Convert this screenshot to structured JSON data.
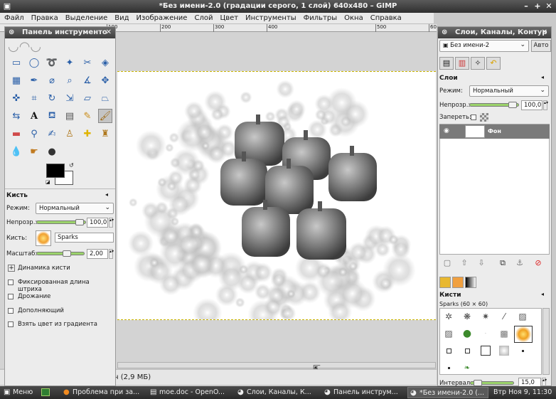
{
  "window": {
    "title": "*Без имени-2.0 (градации серого, 1 слой) 640x480 – GIMP"
  },
  "menubar": [
    "Файл",
    "Правка",
    "Выделение",
    "Вид",
    "Изображение",
    "Слой",
    "Цвет",
    "Инструменты",
    "Фильтры",
    "Окна",
    "Справка"
  ],
  "ruler": {
    "ticks": [
      "100",
      "200",
      "300",
      "400",
      "500",
      "60"
    ]
  },
  "status": {
    "text": "н (2,9 МБ)"
  },
  "toolbox": {
    "title": "Панель инструменто",
    "section": "Кисть",
    "mode_label": "Режим:",
    "mode_value": "Нормальный",
    "opacity_label": "Непрозр.:",
    "opacity_value": "100,0",
    "opacity_fraction": 1.0,
    "brush_label": "Кисть:",
    "brush_value": "Sparks",
    "scale_label": "Масштаб:",
    "scale_value": "2,00",
    "dynamics": "Динамика кисти",
    "options": [
      "Фиксированная длина штриха",
      "Дрожание",
      "Дополняющий",
      "Взять цвет из градиента"
    ]
  },
  "layers": {
    "title": "Слои, Каналы, Контур",
    "image_select": "Без имени-2",
    "auto_button": "Авто",
    "section": "Слои",
    "mode_label": "Режим:",
    "mode_value": "Нормальный",
    "opacity_label": "Непрозр.:",
    "opacity_value": "100,0",
    "lock_label": "Запереть:",
    "layer_name": "Фон",
    "brushes_section": "Кисти",
    "brush_info": "Sparks (60 × 60)",
    "interval_label": "Интервал:",
    "interval_value": "15,0"
  },
  "taskbar": {
    "menu": "Меню",
    "tasks": [
      "Проблема при за...",
      "moe.doc - OpenO...",
      "Слои, Каналы, К...",
      "Панель инструм...",
      "*Без имени-2.0 (..."
    ],
    "clock": "Втр Ноя  9, 11:30"
  },
  "colors": {
    "foreground": "#000000",
    "background": "#ffffff",
    "accent": "#9bd36b"
  }
}
